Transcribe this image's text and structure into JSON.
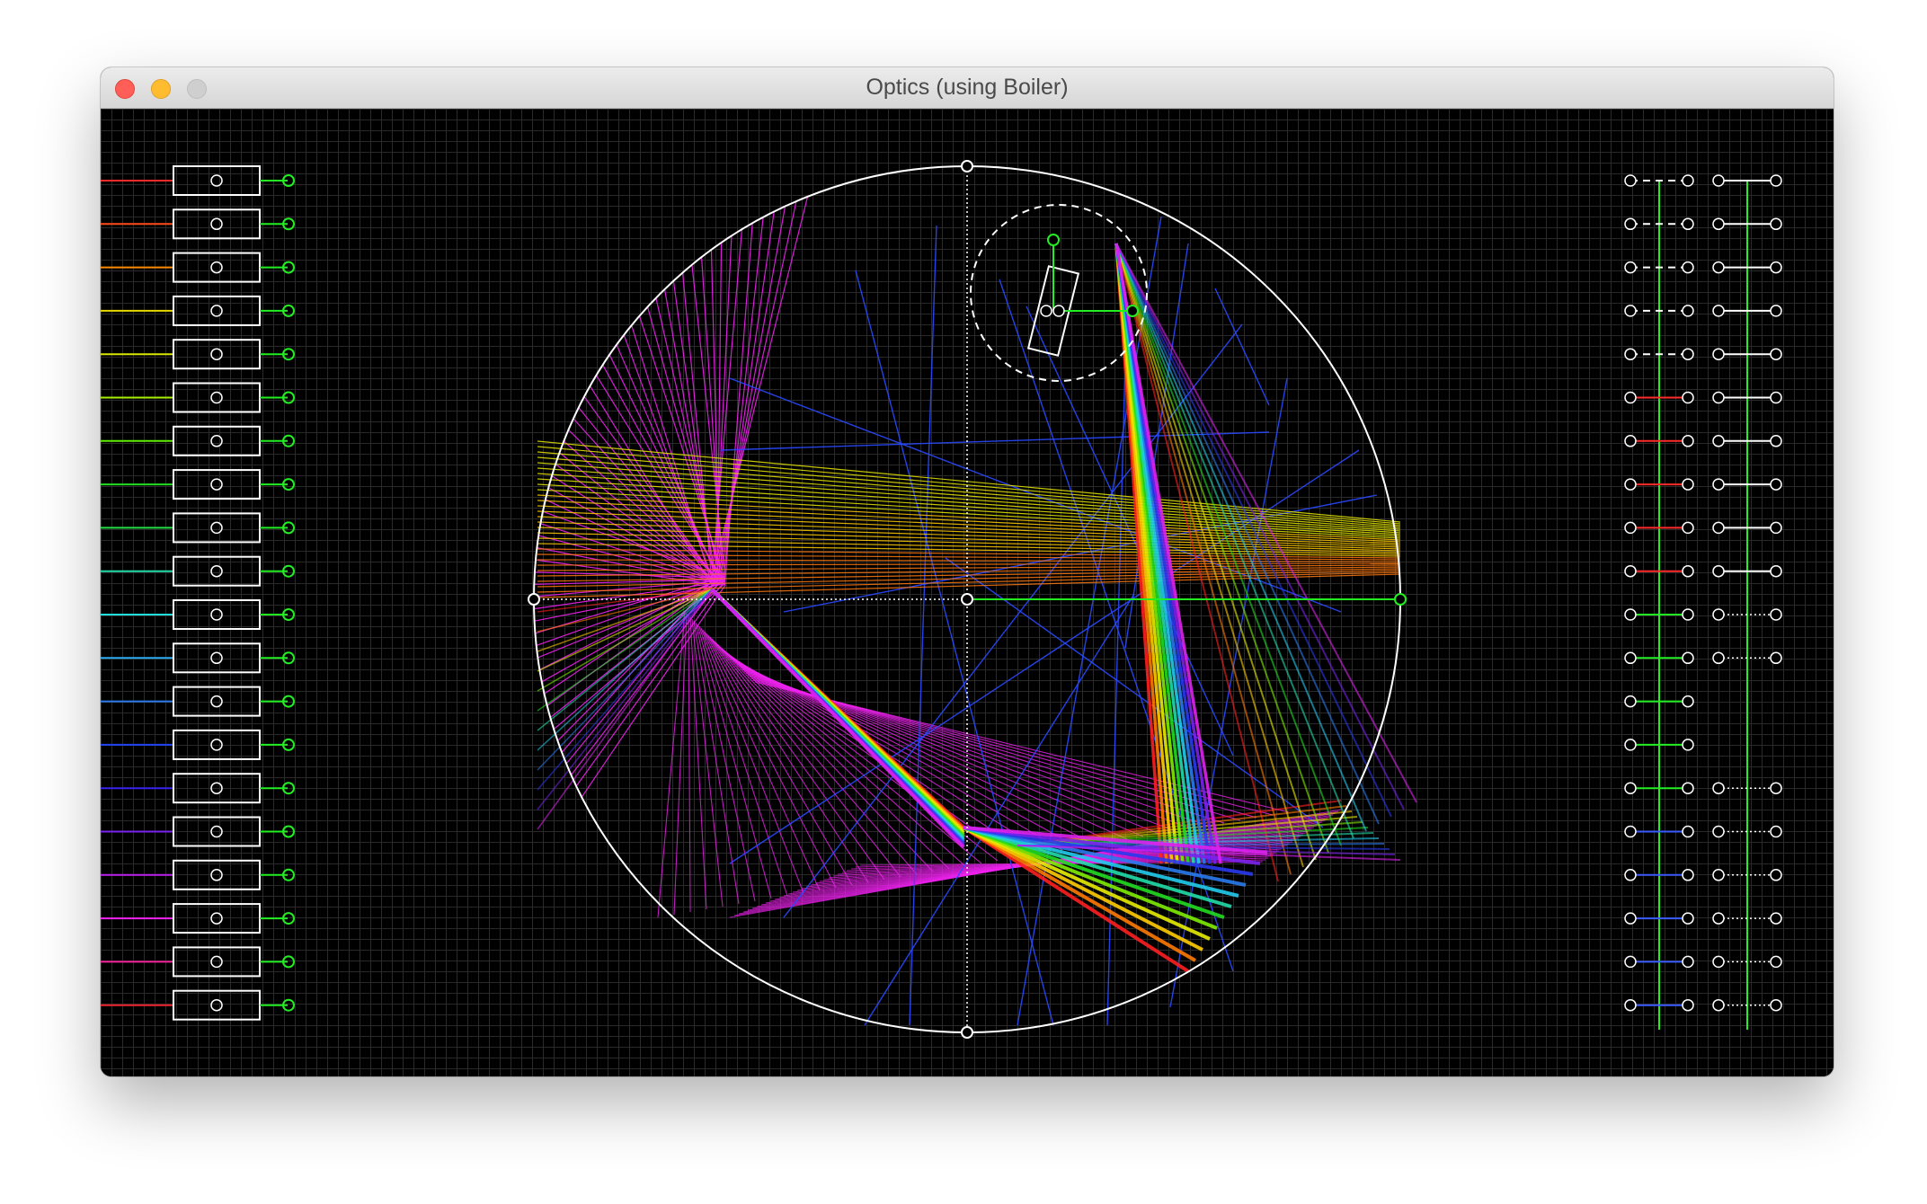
{
  "window": {
    "title": "Optics (using Boiler)",
    "controls": [
      "close-button",
      "minimize-button",
      "zoom-button"
    ]
  },
  "left_panel": {
    "source_count": 20,
    "source_colors": [
      "#ff2a2a",
      "#ff4a1a",
      "#ff8a00",
      "#e8d800",
      "#d8e800",
      "#a8ee00",
      "#60ee00",
      "#22dd22",
      "#22dd44",
      "#22ddaa",
      "#22dddd",
      "#2aaaee",
      "#2a7aee",
      "#2244ee",
      "#3a22ee",
      "#7a22ee",
      "#bb22ee",
      "#ee22ee",
      "#ee2299",
      "#ee2233"
    ]
  },
  "right_panel": {
    "rows": [
      {
        "left": "dashed-white",
        "right": "white"
      },
      {
        "left": "dashed-white",
        "right": "white"
      },
      {
        "left": "dashed-white",
        "right": "white"
      },
      {
        "left": "dashed-white",
        "right": "white"
      },
      {
        "left": "dashed-white",
        "right": "white"
      },
      {
        "left": "red",
        "right": "white"
      },
      {
        "left": "red",
        "right": "white"
      },
      {
        "left": "red",
        "right": "white"
      },
      {
        "left": "red",
        "right": "white"
      },
      {
        "left": "red",
        "right": "white"
      },
      {
        "left": "green",
        "right": "dotted-white"
      },
      {
        "left": "green",
        "right": "dotted-white"
      },
      {
        "left": "green",
        "right": "none"
      },
      {
        "left": "green",
        "right": "none"
      },
      {
        "left": "green",
        "right": "dotted-white"
      },
      {
        "left": "blue",
        "right": "dotted-white"
      },
      {
        "left": "blue",
        "right": "dotted-white"
      },
      {
        "left": "blue",
        "right": "dotted-white"
      },
      {
        "left": "blue",
        "right": "dotted-white"
      },
      {
        "left": "blue",
        "right": "dotted-white"
      }
    ]
  },
  "colors": {
    "background": "#000000",
    "grid": "#2a2a2a",
    "handle": "#22ee22",
    "outline": "#ffffff",
    "magenta": "#ee22ee",
    "blue": "#2244ee",
    "yellow": "#e8e800"
  }
}
